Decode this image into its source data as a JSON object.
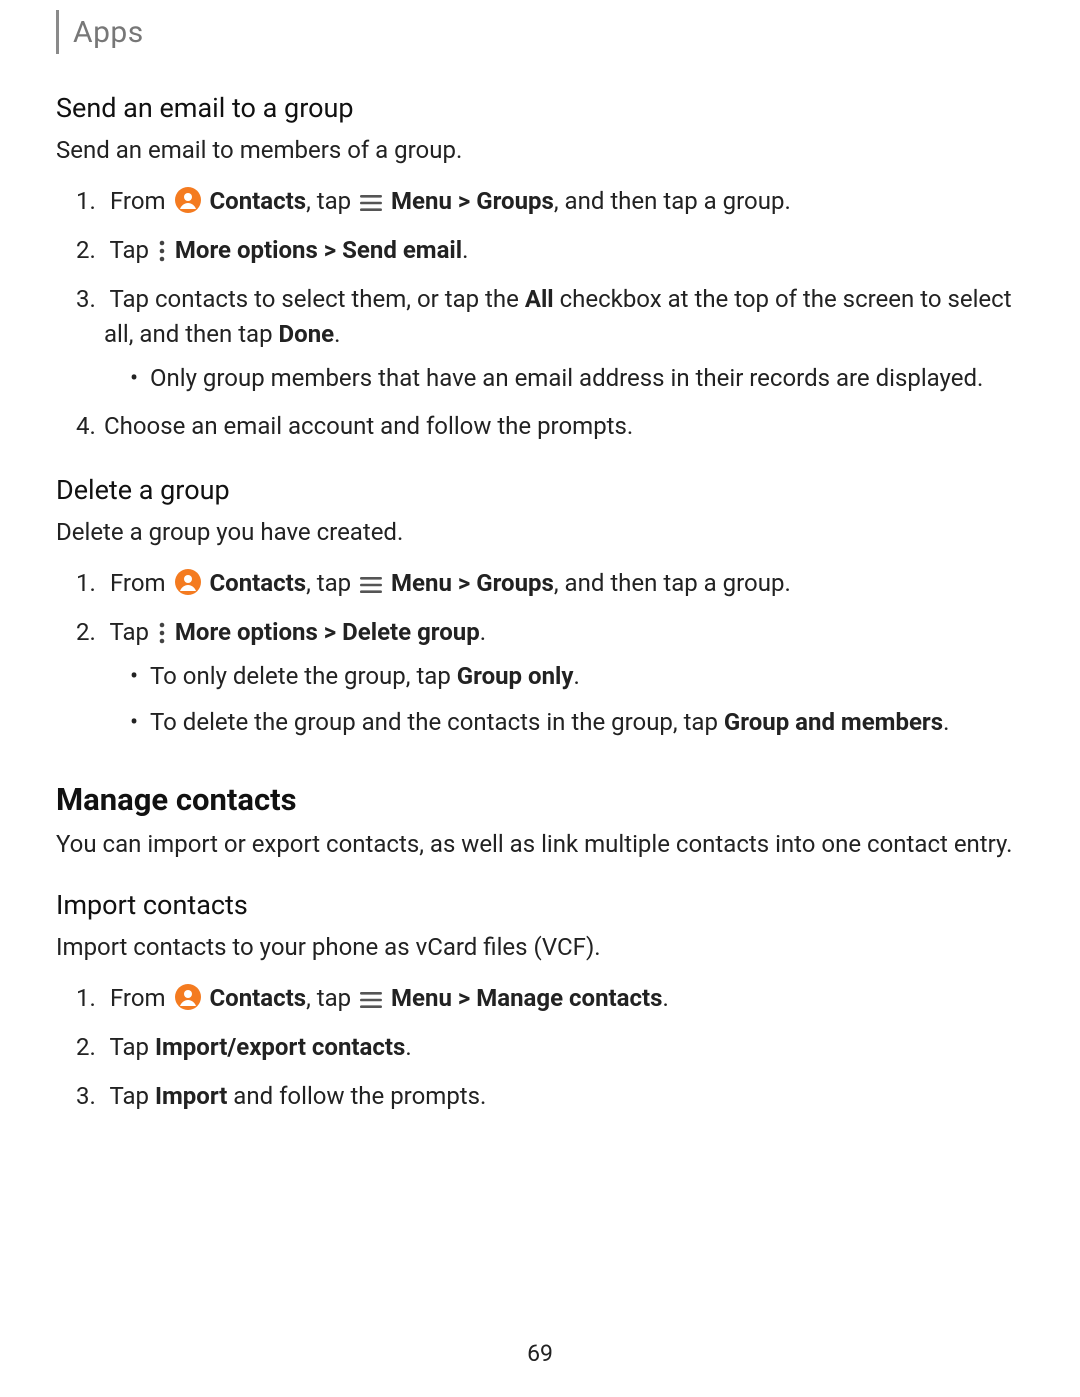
{
  "header": {
    "title": "Apps"
  },
  "pageNumber": "69",
  "s1": {
    "title": "Send an email to a group",
    "intro": "Send an email to members of a group.",
    "step1": {
      "a": "From ",
      "contacts": "Contacts",
      "b": ", tap ",
      "menu": "Menu",
      "sep": " > ",
      "groups": "Groups",
      "c": ", and then tap a group."
    },
    "step2": {
      "a": "Tap ",
      "more": "More options",
      "sep": " > ",
      "send": "Send email",
      "dot": "."
    },
    "step3": {
      "a": "Tap contacts to select them, or tap the ",
      "all": "All",
      "b": " checkbox at the top of the screen to select all, and then tap ",
      "done": "Done",
      "dot": "."
    },
    "step3bullet": "Only group members that have an email address in their records are displayed.",
    "step4": "Choose an email account and follow the prompts."
  },
  "s2": {
    "title": "Delete a group",
    "intro": "Delete a group you have created.",
    "step1": {
      "a": "From ",
      "contacts": "Contacts",
      "b": ", tap ",
      "menu": "Menu",
      "sep": " > ",
      "groups": "Groups",
      "c": ", and then tap a group."
    },
    "step2": {
      "a": "Tap ",
      "more": "More options",
      "sep": " > ",
      "delete": "Delete group",
      "dot": "."
    },
    "b1": {
      "a": "To only delete the group, tap ",
      "go": "Group only",
      "dot": "."
    },
    "b2": {
      "a": "To delete the group and the contacts in the group, tap ",
      "gm": "Group and members",
      "dot": "."
    }
  },
  "s3": {
    "title": "Manage contacts",
    "intro": "You can import or export contacts, as well as link multiple contacts into one contact entry."
  },
  "s4": {
    "title": "Import contacts",
    "intro": "Import contacts to your phone as vCard files (VCF).",
    "step1": {
      "a": "From ",
      "contacts": "Contacts",
      "b": ", tap ",
      "menu": "Menu",
      "sep": " > ",
      "manage": "Manage contacts",
      "dot": "."
    },
    "step2": {
      "a": "Tap ",
      "ie": "Import/export contacts",
      "dot": "."
    },
    "step3": {
      "a": "Tap ",
      "imp": "Import",
      "b": " and follow the prompts."
    }
  }
}
